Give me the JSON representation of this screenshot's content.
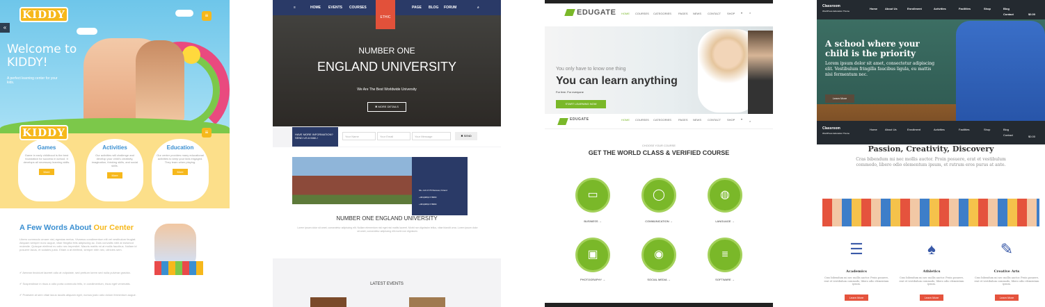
{
  "kiddy": {
    "logo": "KIDDY",
    "welcome_1": "Welcome to",
    "welcome_2": "KIDDY!",
    "subtitle": "A perfect learning center for your kids.",
    "side_icon": "«",
    "menu_icon": "≡",
    "cards": [
      {
        "title": "Games",
        "text": "Game in early childhood is the best foundation for success in school. It develops all necessary learning skills.",
        "button": "More"
      },
      {
        "title": "Activities",
        "text": "Our activities will challenge and develop your child's creativity, imagination, thinking skills, and social skills.",
        "button": "More"
      },
      {
        "title": "Education",
        "text": "Our center provides many educational activities to keep your kids engaged. They learn when playing.",
        "button": "More"
      }
    ],
    "heading_1": "A Few Words About ",
    "heading_2": "Our Center",
    "paragraph": "Libero commodo ornare nisl, egestas metus. Vivamus condimentum elit vel vestibulum feugiat. Aliquam semper nunc augue, vitae fringilla felis adipiscing ac. Duis convallis nibh at euismod molestie. Quisque eleifend eu odio nec imperdiet. Mauris mattis mi at mollis faucibus. Nullam id posuere lacus, et sodales justo. Etiam a at eleifend, semper nibh nec, ultricies sem.",
    "checks": [
      "Aenean tincidunt laoreet odio at vulputate, sed pretium lorem sed nulla pulvinar gravida.",
      "Suspendisse in risus a odio porta commodo felis, in condimentum, risus eget venenatis.",
      "Praesent at sem vitae lacus iaculis aliquam eget, numus justo odio dolum fermentum augue."
    ]
  },
  "university": {
    "nav": [
      "≡",
      "HOME",
      "EVENTS",
      "COURSES",
      "PAGE",
      "BLOG",
      "FORUM",
      "⌕"
    ],
    "logo": "ETHIC",
    "number_one": "NUMBER ONE",
    "england": "ENGLAND UNIVERSITY",
    "tagline": "We Are The Best Worldwide University",
    "more_button": "✖ MORE DETAILS",
    "form_label": "HAVE MORE INFORMATION? SEND US A MAIL!",
    "fields": [
      "Your Name",
      "Your Email",
      "Your Message"
    ],
    "send": "✖ SEND",
    "info": [
      "99+ 123 4778 Warsaw, Poland",
      "+084(088)1778880",
      "+084(088)1778880"
    ],
    "section_title": "NUMBER ONE ENGLAND UNIVERSITY",
    "section_text": "Lorem ipsum dolor sit amet, consectetur adipiscing elit. Nullam elementum nisl eget nisi mattis laoreet. Morbi non dignissim tellus, vitae blandit urna. Lorem ipsum dolor sit amet, consectetur adipiscing elit morbi non dignissim.",
    "events": "LATEST EVENTS"
  },
  "edugate": {
    "logo": "EDUGATE",
    "nav": [
      "HOME",
      "COURSES",
      "CATEGORIES",
      "PAGES",
      "NEWS",
      "CONTACT",
      "SHOP",
      "▾",
      "⌕"
    ],
    "hero_pre": "You only have to know one thing",
    "hero_title": "You can learn anything",
    "hero_sub": "For free. For everyone",
    "hero_button": "START LEARNING NOW",
    "choose": "CHOOSE YOUR COURSE",
    "get_title": "GET THE WORLD CLASS & VERIFIED COURSE",
    "courses": [
      {
        "label": "BUSINESS →",
        "icon": "▭"
      },
      {
        "label": "COMMUNICATION →",
        "icon": "◯"
      },
      {
        "label": "LANGUAGE →",
        "icon": "◍"
      },
      {
        "label": "PHOTOGRAPHY →",
        "icon": "▣"
      },
      {
        "label": "SOCIAL MEDIA →",
        "icon": "◉"
      },
      {
        "label": "SOFTWARE →",
        "icon": "≡"
      }
    ]
  },
  "classroom": {
    "brand": "Classroom",
    "brand_sub": "WordPress Education Theme",
    "nav": [
      "Home",
      "About Us",
      "Enrollment",
      "Activities",
      "Facilities",
      "Shop",
      "Blog",
      "Contact"
    ],
    "cart": "$0.00",
    "hero_title": "A school where your child is the priority",
    "hero_text": "Lorem ipsum dolor sit amet, consectetur adipiscing elit. Vestibulum fringilla faucibus ligula, eu mattis nisi fermentum nec.",
    "learn_more": "Learn More",
    "passion": "Passion, Creativity, Discovery",
    "passion_text": "Cras bibendum mi nec mollis auctor. Proin posuere, erat et vestibulum commodo, libero odio elementum ipsum, et rutrum eros purus at ante.",
    "features": [
      {
        "title": "Academics",
        "icon": "☰",
        "text": "Cras bibendum mi nec mollis auctor. Proin posuere, erat et vestibulum commodo, libero odio elementum ipsum.",
        "button": "Learn More"
      },
      {
        "title": "Athletics",
        "icon": "♠",
        "text": "Cras bibendum mi nec mollis auctor. Proin posuere, erat et vestibulum commodo, libero odio elementum ipsum.",
        "button": "Learn More"
      },
      {
        "title": "Creative Arts",
        "icon": "✎",
        "text": "Cras bibendum mi nec mollis auctor. Proin posuere, erat et vestibulum commodo, libero odio elementum ipsum.",
        "button": "Learn More"
      }
    ]
  }
}
